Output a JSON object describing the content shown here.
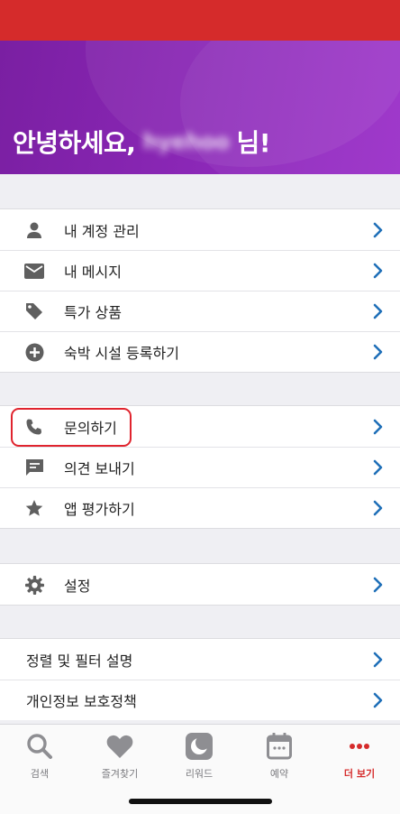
{
  "colors": {
    "status_bar": "#d52b2b",
    "hero_purple": "#8a26b5",
    "chevron": "#1f6fb8",
    "icon": "#5f5f5f",
    "highlight": "#e0242e",
    "active_tab": "#d52b2b"
  },
  "header": {
    "greeting_prefix": "안녕하세요,",
    "user_name": "hyehoo",
    "greeting_suffix": "님!"
  },
  "menu": {
    "account": [
      {
        "label": "내 계정 관리",
        "icon": "person-icon"
      },
      {
        "label": "내 메시지",
        "icon": "mail-icon"
      },
      {
        "label": "특가 상품",
        "icon": "tag-icon"
      },
      {
        "label": "숙박 시설 등록하기",
        "icon": "plus-circle-icon"
      }
    ],
    "support": [
      {
        "label": "문의하기",
        "icon": "phone-icon"
      },
      {
        "label": "의견 보내기",
        "icon": "feedback-icon"
      },
      {
        "label": "앱 평가하기",
        "icon": "star-icon"
      }
    ],
    "settings": [
      {
        "label": "설정",
        "icon": "gear-icon"
      }
    ],
    "info": [
      {
        "label": "정렬 및 필터 설명"
      },
      {
        "label": "개인정보 보호정책"
      }
    ]
  },
  "tabs": [
    {
      "label": "검색",
      "icon": "search-icon"
    },
    {
      "label": "즐겨찾기",
      "icon": "heart-icon"
    },
    {
      "label": "리워드",
      "icon": "moon-icon"
    },
    {
      "label": "예약",
      "icon": "calendar-icon"
    },
    {
      "label": "더 보기",
      "icon": "more-icon",
      "active": true
    }
  ]
}
